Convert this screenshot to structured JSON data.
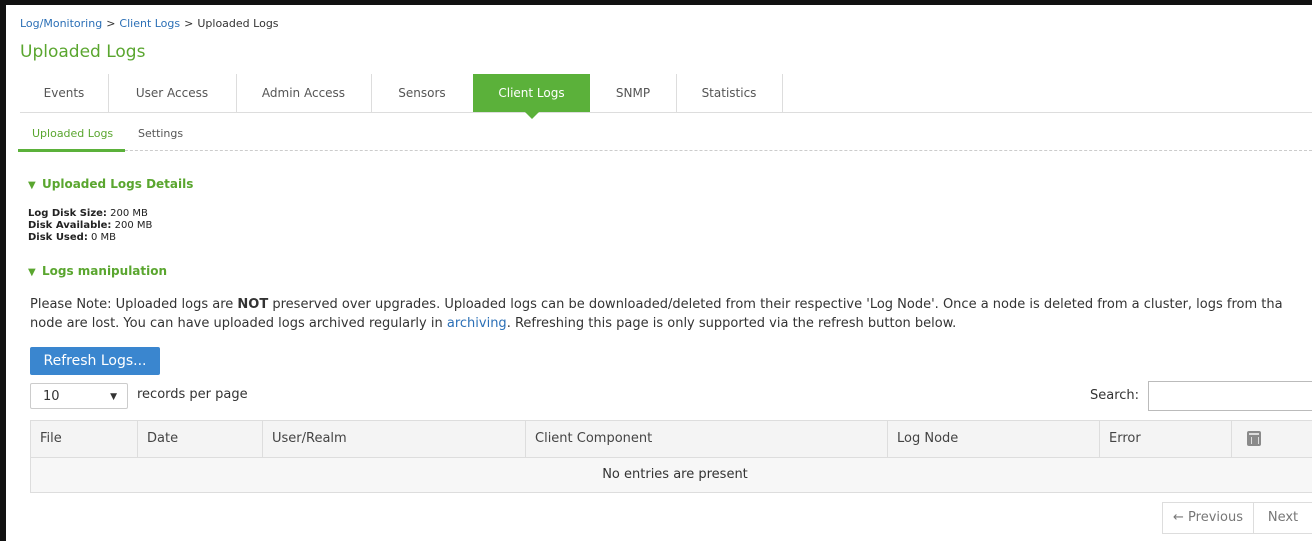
{
  "breadcrumb": {
    "items": [
      "Log/Monitoring",
      "Client Logs",
      "Uploaded Logs"
    ],
    "separator": ">"
  },
  "page_title": "Uploaded Logs",
  "tabs": [
    {
      "label": "Events"
    },
    {
      "label": "User Access"
    },
    {
      "label": "Admin Access"
    },
    {
      "label": "Sensors"
    },
    {
      "label": "Client Logs",
      "active": true
    },
    {
      "label": "SNMP"
    },
    {
      "label": "Statistics"
    }
  ],
  "subtabs": [
    {
      "label": "Uploaded Logs",
      "active": true
    },
    {
      "label": "Settings"
    }
  ],
  "details": {
    "heading": "Uploaded Logs Details",
    "chevron_icon": "chevron-down-icon",
    "disk_size_label": "Log Disk Size:",
    "disk_size_value": "200 MB",
    "disk_available_label": "Disk Available:",
    "disk_available_value": "200 MB",
    "disk_used_label": "Disk Used:",
    "disk_used_value": "0 MB"
  },
  "manipulation": {
    "heading": "Logs manipulation",
    "note_part1": "Please Note: Uploaded logs are ",
    "note_bold": "NOT",
    "note_part2": " preserved over upgrades. Uploaded logs can be downloaded/deleted from their respective 'Log Node'. Once a node is deleted from a cluster, logs from tha",
    "note_line2_part1": "node are lost. You can have uploaded logs archived regularly in ",
    "note_link": "archiving",
    "note_line2_part2": ". Refreshing this page is only supported via the refresh button below."
  },
  "refresh_button": "Refresh Logs...",
  "records": {
    "selected": "10",
    "label": "records per page"
  },
  "search": {
    "label": "Search:",
    "value": ""
  },
  "table": {
    "columns": [
      "File",
      "Date",
      "User/Realm",
      "Client Component",
      "Log Node",
      "Error"
    ],
    "delete_icon": "trash-icon",
    "empty_message": "No entries are present"
  },
  "pagination": {
    "previous": "← Previous",
    "next": "Next"
  },
  "colors": {
    "accent_green": "#5bb13a",
    "link_blue": "#2b6fb6",
    "button_blue": "#3a86cf"
  }
}
